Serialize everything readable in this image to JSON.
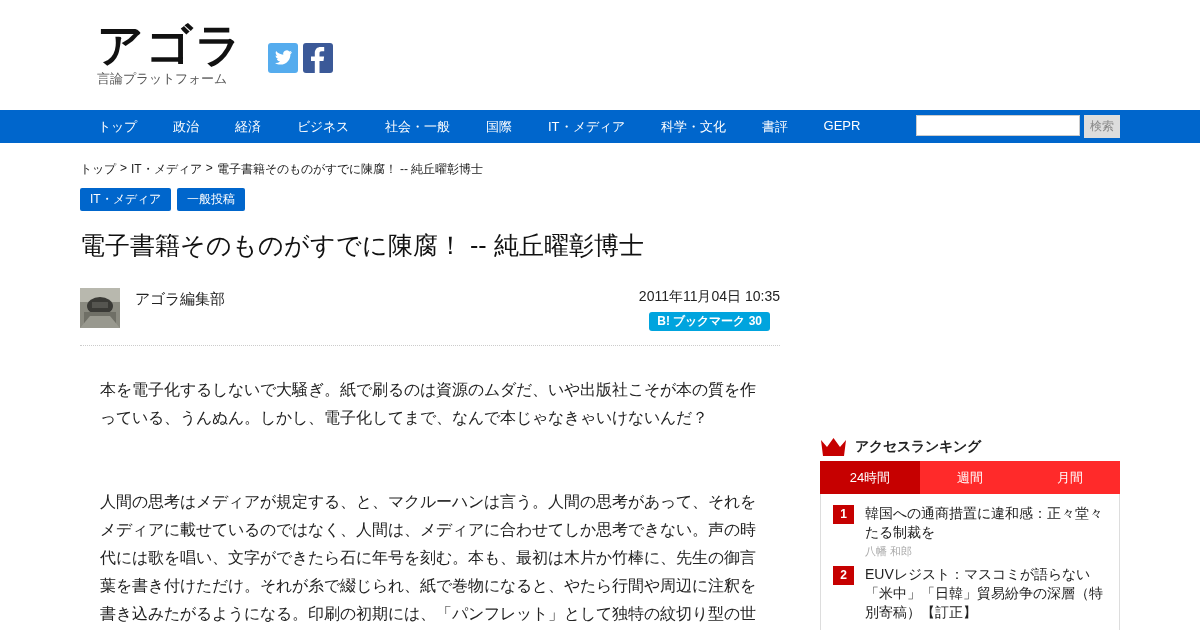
{
  "logo": {
    "title": "アゴラ",
    "subtitle": "言論プラットフォーム"
  },
  "nav": {
    "items": [
      "トップ",
      "政治",
      "経済",
      "ビジネス",
      "社会・一般",
      "国際",
      "IT・メディア",
      "科学・文化",
      "書評",
      "GEPR"
    ],
    "search_button": "検索"
  },
  "breadcrumb": {
    "separator": ">",
    "items": [
      "トップ",
      "IT・メディア",
      "電子書籍そのものがすでに陳腐！ -- 純丘曜彰博士"
    ]
  },
  "tags": [
    "IT・メディア",
    "一般投稿"
  ],
  "article": {
    "title": "電子書籍そのものがすでに陳腐！ -- 純丘曜彰博士",
    "author": "アゴラ編集部",
    "date": "2011年11月04日 10:35",
    "bookmark": {
      "label": "B! ブックマーク",
      "count": "30"
    },
    "paragraphs": [
      "本を電子化するしないで大騒ぎ。紙で刷るのは資源のムダだ、いや出版社こそが本の質を作っている、うんぬん。しかし、電子化してまで、なんで本じゃなきゃいけないんだ？",
      "人間の思考はメディアが規定する、と、マクルーハンは言う。人間の思考があって、それをメディアに載せているのではなく、人間は、メディアに合わせてしか思考できない。声の時代には歌を唱い、文字ができたら石に年号を刻む。本も、最初は木片か竹棒に、先生の御言葉を書き付けただけ。それが糸で綴じられ、紙で巻物になると、やたら行間や周辺に注釈を書き込みたがるようになる。印刷の初期には、「パンフレット」として独特の紋切り型の世"
    ]
  },
  "ranking": {
    "title": "アクセスランキング",
    "tabs": [
      {
        "label": "24時間",
        "selected": true
      },
      {
        "label": "週間",
        "selected": false
      },
      {
        "label": "月間",
        "selected": false
      }
    ],
    "items": [
      {
        "rank": "1",
        "title": "韓国への通商措置に違和感：正々堂々たる制裁を",
        "author": "八幡 和郎"
      },
      {
        "rank": "2",
        "title": "EUVレジスト：マスコミが語らない「米中」「日韓」貿易紛争の深層（特別寄稿）【訂正】"
      }
    ]
  }
}
